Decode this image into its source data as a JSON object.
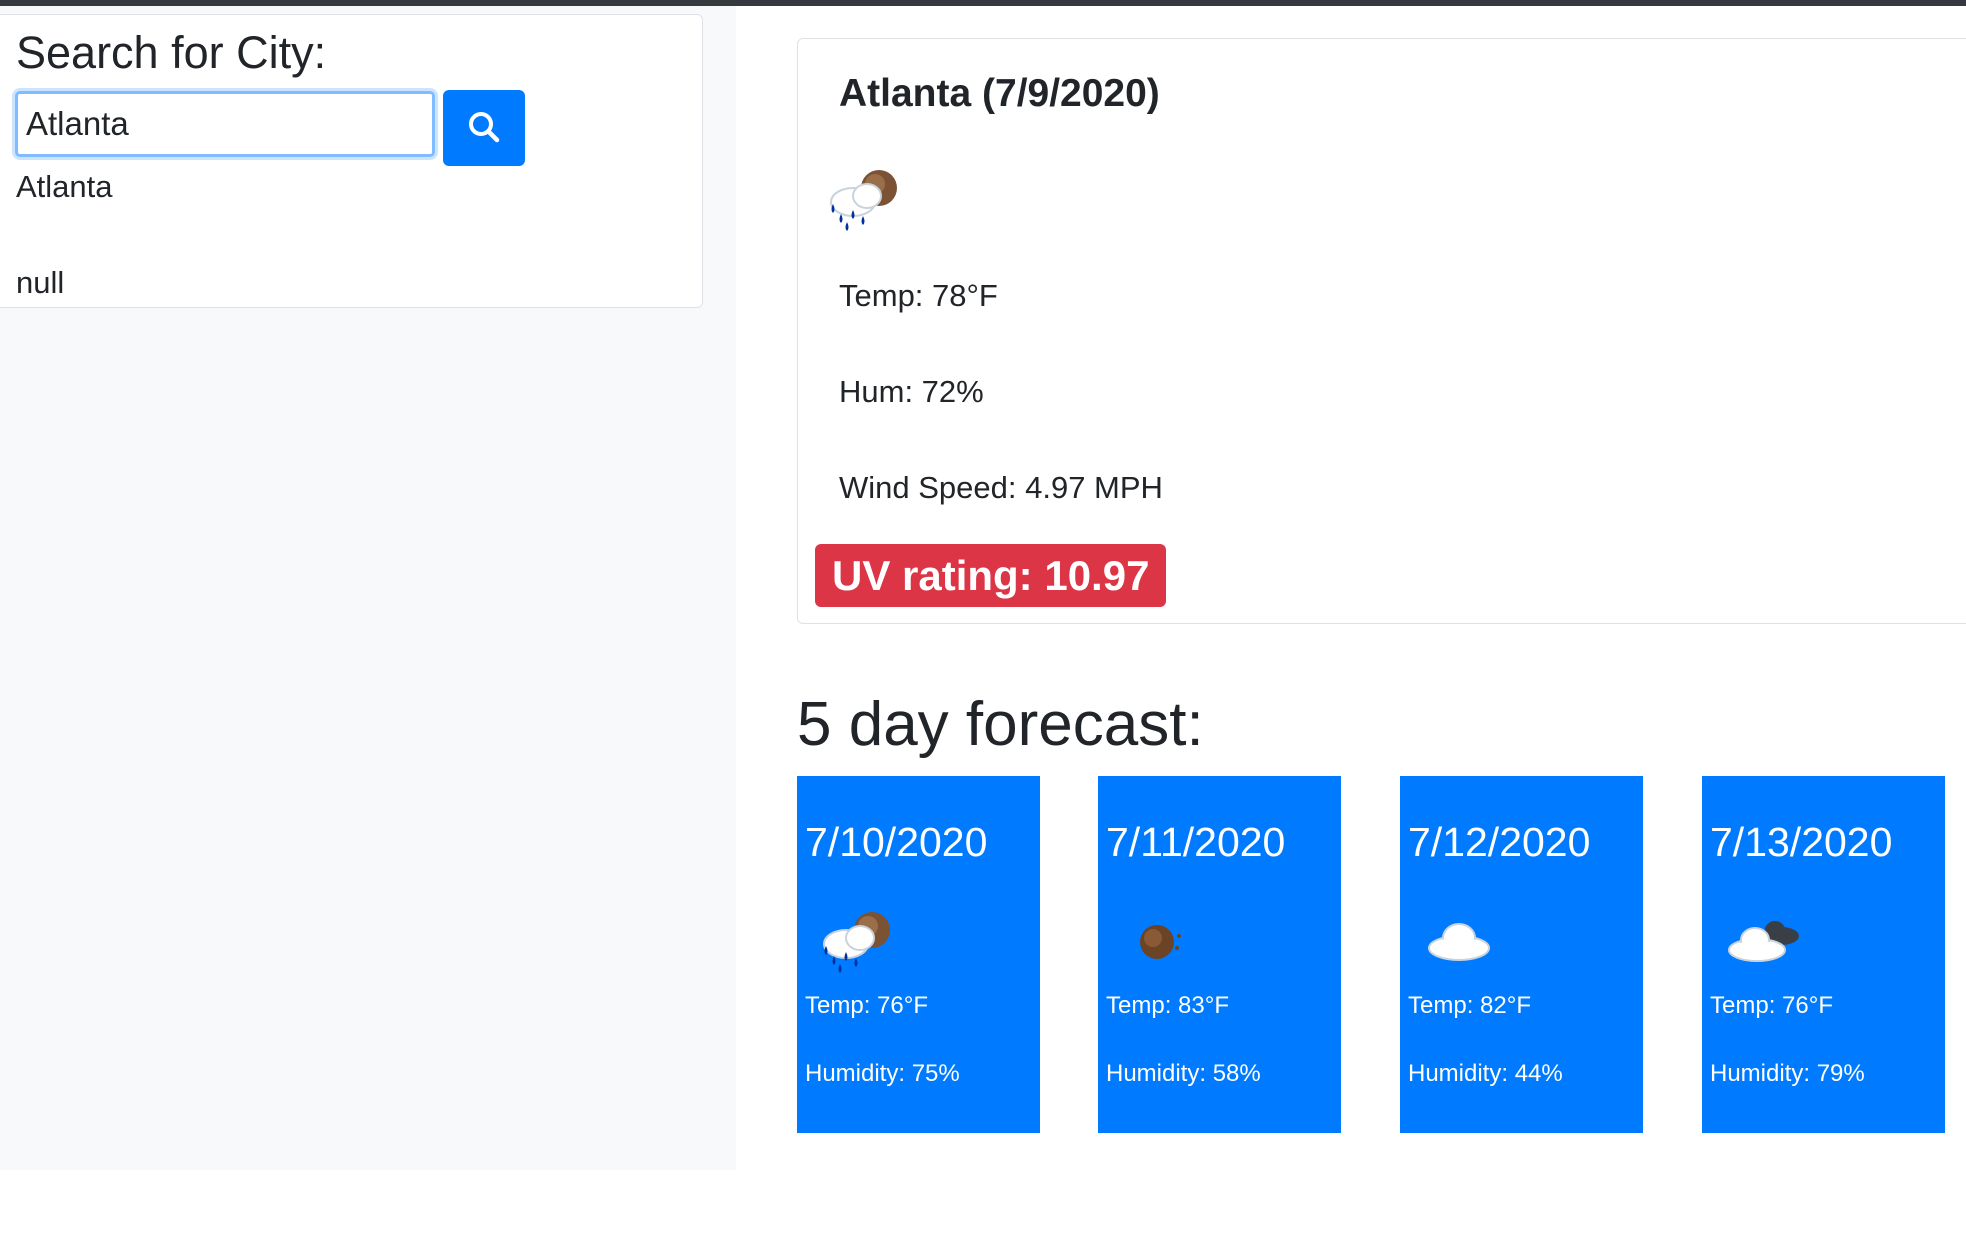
{
  "search": {
    "title": "Search for City:",
    "input_value": "Atlanta",
    "button_icon": "search-icon",
    "history": [
      "Atlanta",
      "null"
    ]
  },
  "current": {
    "title": "Atlanta (7/9/2020)",
    "icon": "rain-cloud-sun-icon",
    "temp": "Temp: 78°F",
    "humidity": "Hum: 72%",
    "wind": "Wind Speed: 4.97 MPH",
    "uv": "UV rating: 10.97"
  },
  "forecast": {
    "title": "5 day forecast:",
    "days": [
      {
        "date": "7/10/2020",
        "icon": "rain-cloud-sun-icon",
        "temp": "Temp: 76°F",
        "humidity": "Humidity: 75%"
      },
      {
        "date": "7/11/2020",
        "icon": "sun-icon",
        "temp": "Temp: 83°F",
        "humidity": "Humidity: 58%"
      },
      {
        "date": "7/12/2020",
        "icon": "cloud-icon",
        "temp": "Temp: 82°F",
        "humidity": "Humidity: 44%"
      },
      {
        "date": "7/13/2020",
        "icon": "broken-clouds-icon",
        "temp": "Temp: 76°F",
        "humidity": "Humidity: 79%"
      }
    ]
  },
  "colors": {
    "primary": "#007bff",
    "danger": "#dc3545",
    "sidebar_bg": "#f8f9fa",
    "topbar": "#343a40"
  }
}
